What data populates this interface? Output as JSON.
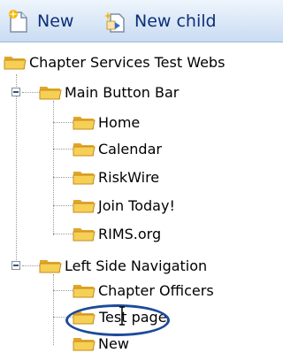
{
  "toolbar": {
    "new_label": "New",
    "new_child_label": "New child"
  },
  "tree": {
    "root": "Chapter Services Test Webs",
    "main_button_bar": {
      "label": "Main Button Bar",
      "children": [
        "Home",
        "Calendar",
        "RiskWire",
        "Join Today!",
        "RIMS.org"
      ]
    },
    "left_side_navigation": {
      "label": "Left Side Navigation",
      "children": [
        "Chapter Officers",
        "Test page",
        "New"
      ]
    }
  },
  "colors": {
    "toolbar_text": "#0c2f7a",
    "folder": "#f3c34a",
    "highlight_ring": "#1c4a9b"
  }
}
